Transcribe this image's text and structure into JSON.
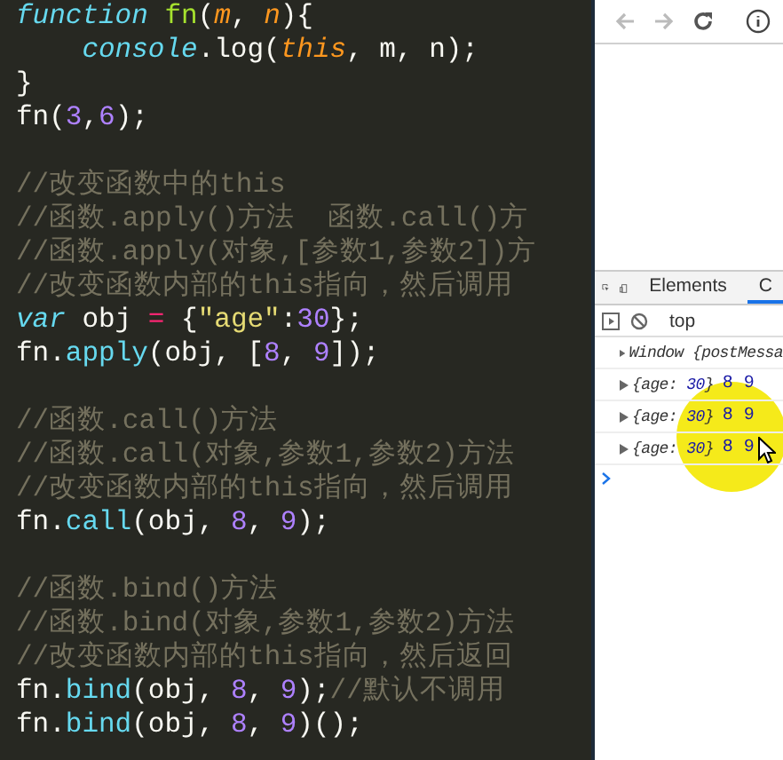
{
  "editor": {
    "blocks": [
      [
        {
          "tokens": [
            {
              "text": "function ",
              "kind": "keyword"
            },
            {
              "text": "fn",
              "kind": "func"
            },
            {
              "text": "(",
              "kind": "plain"
            },
            {
              "text": "m",
              "kind": "param"
            },
            {
              "text": ", ",
              "kind": "plain"
            },
            {
              "text": "n",
              "kind": "param"
            },
            {
              "text": "){",
              "kind": "plain"
            }
          ]
        },
        {
          "tokens": [
            {
              "text": "    console",
              "kind": "builtin"
            },
            {
              "text": ".log(",
              "kind": "plain"
            },
            {
              "text": "this",
              "kind": "param"
            },
            {
              "text": ", m, n);",
              "kind": "plain"
            }
          ]
        },
        {
          "tokens": [
            {
              "text": "}",
              "kind": "plain"
            }
          ]
        },
        {
          "tokens": [
            {
              "text": "fn(",
              "kind": "plain"
            },
            {
              "text": "3",
              "kind": "number"
            },
            {
              "text": ",",
              "kind": "plain"
            },
            {
              "text": "6",
              "kind": "number"
            },
            {
              "text": ");",
              "kind": "plain"
            }
          ]
        }
      ],
      [
        {
          "tokens": [
            {
              "text": "//改变函数中的this",
              "kind": "comment"
            }
          ]
        },
        {
          "tokens": [
            {
              "text": "//函数.apply()方法  函数.call()方",
              "kind": "comment"
            }
          ]
        },
        {
          "tokens": [
            {
              "text": "//函数.apply(对象,[参数1,参数2])方",
              "kind": "comment"
            }
          ]
        },
        {
          "tokens": [
            {
              "text": "//改变函数内部的this指向，然后调用",
              "kind": "comment"
            }
          ]
        },
        {
          "tokens": [
            {
              "text": "var",
              "kind": "keyword"
            },
            {
              "text": " obj ",
              "kind": "plain"
            },
            {
              "text": "=",
              "kind": "operator"
            },
            {
              "text": " {",
              "kind": "plain"
            },
            {
              "text": "\"age\"",
              "kind": "string"
            },
            {
              "text": ":",
              "kind": "plain"
            },
            {
              "text": "30",
              "kind": "number"
            },
            {
              "text": "};",
              "kind": "plain"
            }
          ]
        },
        {
          "tokens": [
            {
              "text": "fn.",
              "kind": "plain"
            },
            {
              "text": "apply",
              "kind": "method"
            },
            {
              "text": "(obj, [",
              "kind": "plain"
            },
            {
              "text": "8",
              "kind": "number"
            },
            {
              "text": ", ",
              "kind": "plain"
            },
            {
              "text": "9",
              "kind": "number"
            },
            {
              "text": "]);",
              "kind": "plain"
            }
          ]
        }
      ],
      [
        {
          "tokens": [
            {
              "text": "//函数.call()方法",
              "kind": "comment"
            }
          ]
        },
        {
          "tokens": [
            {
              "text": "//函数.call(对象,参数1,参数2)方法",
              "kind": "comment"
            }
          ]
        },
        {
          "tokens": [
            {
              "text": "//改变函数内部的this指向，然后调用",
              "kind": "comment"
            }
          ]
        },
        {
          "tokens": [
            {
              "text": "fn.",
              "kind": "plain"
            },
            {
              "text": "call",
              "kind": "method"
            },
            {
              "text": "(obj, ",
              "kind": "plain"
            },
            {
              "text": "8",
              "kind": "number"
            },
            {
              "text": ", ",
              "kind": "plain"
            },
            {
              "text": "9",
              "kind": "number"
            },
            {
              "text": ");",
              "kind": "plain"
            }
          ]
        }
      ],
      [
        {
          "tokens": [
            {
              "text": "//函数.bind()方法",
              "kind": "comment"
            }
          ]
        },
        {
          "tokens": [
            {
              "text": "//函数.bind(对象,参数1,参数2)方法",
              "kind": "comment"
            }
          ]
        },
        {
          "tokens": [
            {
              "text": "//改变函数内部的this指向，然后返回",
              "kind": "comment"
            }
          ]
        },
        {
          "tokens": [
            {
              "text": "fn.",
              "kind": "plain"
            },
            {
              "text": "bind",
              "kind": "method"
            },
            {
              "text": "(obj, ",
              "kind": "plain"
            },
            {
              "text": "8",
              "kind": "number"
            },
            {
              "text": ", ",
              "kind": "plain"
            },
            {
              "text": "9",
              "kind": "number"
            },
            {
              "text": ");",
              "kind": "plain"
            },
            {
              "text": "//默认不调用",
              "kind": "comment"
            }
          ]
        },
        {
          "tokens": [
            {
              "text": "fn.",
              "kind": "plain"
            },
            {
              "text": "bind",
              "kind": "method"
            },
            {
              "text": "(obj, ",
              "kind": "plain"
            },
            {
              "text": "8",
              "kind": "number"
            },
            {
              "text": ", ",
              "kind": "plain"
            },
            {
              "text": "9",
              "kind": "number"
            },
            {
              "text": ")();",
              "kind": "plain"
            }
          ]
        }
      ]
    ]
  },
  "devtools": {
    "tabs": [
      {
        "label": "Elements",
        "selected": false
      },
      {
        "label": "C",
        "selected": true
      }
    ],
    "context": "top",
    "messages": [
      {
        "parts": [
          {
            "text": "Window {postMessa",
            "kind": "plain"
          }
        ]
      },
      {
        "parts": [
          {
            "text": "{age: ",
            "kind": "plain"
          },
          {
            "text": "30",
            "kind": "number"
          },
          {
            "text": "}",
            "kind": "plain"
          }
        ],
        "args": "8 9"
      },
      {
        "parts": [
          {
            "text": "{age: ",
            "kind": "plain"
          },
          {
            "text": "30",
            "kind": "number"
          },
          {
            "text": "}",
            "kind": "plain"
          }
        ],
        "args": "8 9"
      },
      {
        "parts": [
          {
            "text": "{age: ",
            "kind": "plain"
          },
          {
            "text": "30",
            "kind": "number"
          },
          {
            "text": "}",
            "kind": "plain"
          }
        ],
        "args": "8 9"
      }
    ]
  }
}
